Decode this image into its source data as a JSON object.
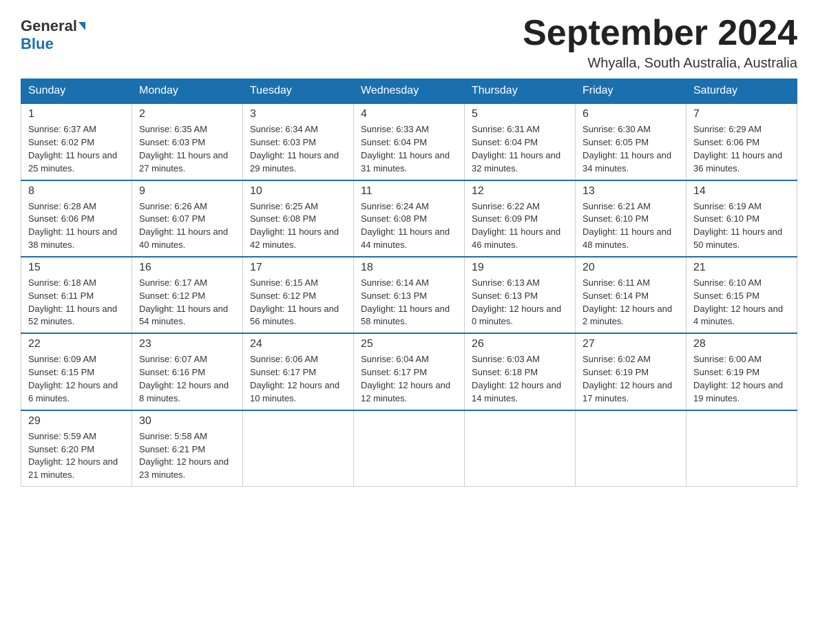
{
  "header": {
    "logo": {
      "general": "General",
      "arrow": "▶",
      "blue": "Blue"
    },
    "title": "September 2024",
    "subtitle": "Whyalla, South Australia, Australia"
  },
  "calendar": {
    "days_of_week": [
      "Sunday",
      "Monday",
      "Tuesday",
      "Wednesday",
      "Thursday",
      "Friday",
      "Saturday"
    ],
    "weeks": [
      [
        {
          "day": "1",
          "sunrise": "6:37 AM",
          "sunset": "6:02 PM",
          "daylight": "11 hours and 25 minutes."
        },
        {
          "day": "2",
          "sunrise": "6:35 AM",
          "sunset": "6:03 PM",
          "daylight": "11 hours and 27 minutes."
        },
        {
          "day": "3",
          "sunrise": "6:34 AM",
          "sunset": "6:03 PM",
          "daylight": "11 hours and 29 minutes."
        },
        {
          "day": "4",
          "sunrise": "6:33 AM",
          "sunset": "6:04 PM",
          "daylight": "11 hours and 31 minutes."
        },
        {
          "day": "5",
          "sunrise": "6:31 AM",
          "sunset": "6:04 PM",
          "daylight": "11 hours and 32 minutes."
        },
        {
          "day": "6",
          "sunrise": "6:30 AM",
          "sunset": "6:05 PM",
          "daylight": "11 hours and 34 minutes."
        },
        {
          "day": "7",
          "sunrise": "6:29 AM",
          "sunset": "6:06 PM",
          "daylight": "11 hours and 36 minutes."
        }
      ],
      [
        {
          "day": "8",
          "sunrise": "6:28 AM",
          "sunset": "6:06 PM",
          "daylight": "11 hours and 38 minutes."
        },
        {
          "day": "9",
          "sunrise": "6:26 AM",
          "sunset": "6:07 PM",
          "daylight": "11 hours and 40 minutes."
        },
        {
          "day": "10",
          "sunrise": "6:25 AM",
          "sunset": "6:08 PM",
          "daylight": "11 hours and 42 minutes."
        },
        {
          "day": "11",
          "sunrise": "6:24 AM",
          "sunset": "6:08 PM",
          "daylight": "11 hours and 44 minutes."
        },
        {
          "day": "12",
          "sunrise": "6:22 AM",
          "sunset": "6:09 PM",
          "daylight": "11 hours and 46 minutes."
        },
        {
          "day": "13",
          "sunrise": "6:21 AM",
          "sunset": "6:10 PM",
          "daylight": "11 hours and 48 minutes."
        },
        {
          "day": "14",
          "sunrise": "6:19 AM",
          "sunset": "6:10 PM",
          "daylight": "11 hours and 50 minutes."
        }
      ],
      [
        {
          "day": "15",
          "sunrise": "6:18 AM",
          "sunset": "6:11 PM",
          "daylight": "11 hours and 52 minutes."
        },
        {
          "day": "16",
          "sunrise": "6:17 AM",
          "sunset": "6:12 PM",
          "daylight": "11 hours and 54 minutes."
        },
        {
          "day": "17",
          "sunrise": "6:15 AM",
          "sunset": "6:12 PM",
          "daylight": "11 hours and 56 minutes."
        },
        {
          "day": "18",
          "sunrise": "6:14 AM",
          "sunset": "6:13 PM",
          "daylight": "11 hours and 58 minutes."
        },
        {
          "day": "19",
          "sunrise": "6:13 AM",
          "sunset": "6:13 PM",
          "daylight": "12 hours and 0 minutes."
        },
        {
          "day": "20",
          "sunrise": "6:11 AM",
          "sunset": "6:14 PM",
          "daylight": "12 hours and 2 minutes."
        },
        {
          "day": "21",
          "sunrise": "6:10 AM",
          "sunset": "6:15 PM",
          "daylight": "12 hours and 4 minutes."
        }
      ],
      [
        {
          "day": "22",
          "sunrise": "6:09 AM",
          "sunset": "6:15 PM",
          "daylight": "12 hours and 6 minutes."
        },
        {
          "day": "23",
          "sunrise": "6:07 AM",
          "sunset": "6:16 PM",
          "daylight": "12 hours and 8 minutes."
        },
        {
          "day": "24",
          "sunrise": "6:06 AM",
          "sunset": "6:17 PM",
          "daylight": "12 hours and 10 minutes."
        },
        {
          "day": "25",
          "sunrise": "6:04 AM",
          "sunset": "6:17 PM",
          "daylight": "12 hours and 12 minutes."
        },
        {
          "day": "26",
          "sunrise": "6:03 AM",
          "sunset": "6:18 PM",
          "daylight": "12 hours and 14 minutes."
        },
        {
          "day": "27",
          "sunrise": "6:02 AM",
          "sunset": "6:19 PM",
          "daylight": "12 hours and 17 minutes."
        },
        {
          "day": "28",
          "sunrise": "6:00 AM",
          "sunset": "6:19 PM",
          "daylight": "12 hours and 19 minutes."
        }
      ],
      [
        {
          "day": "29",
          "sunrise": "5:59 AM",
          "sunset": "6:20 PM",
          "daylight": "12 hours and 21 minutes."
        },
        {
          "day": "30",
          "sunrise": "5:58 AM",
          "sunset": "6:21 PM",
          "daylight": "12 hours and 23 minutes."
        },
        null,
        null,
        null,
        null,
        null
      ]
    ]
  }
}
